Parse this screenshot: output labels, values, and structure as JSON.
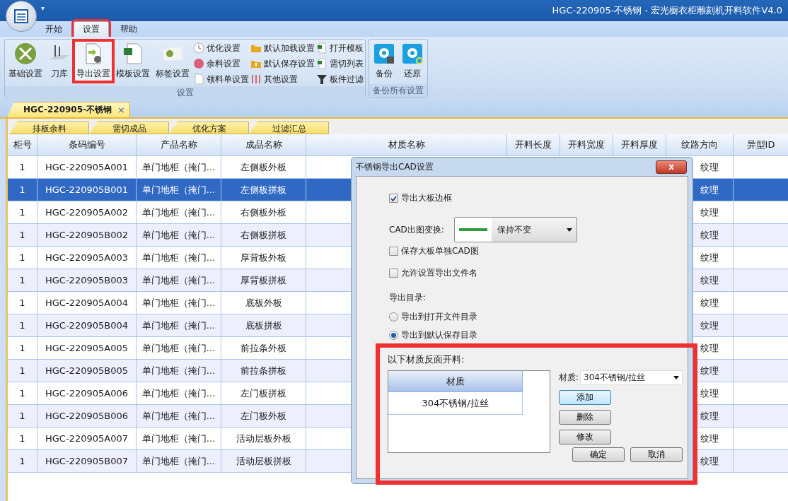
{
  "window": {
    "title": "HGC-220905-不锈钢 - 宏光橱衣柜雕刻机开料软件V4.0",
    "menu_caret": "▾"
  },
  "ribbon": {
    "tabs": [
      {
        "label": "开始",
        "selected": false,
        "highlighted": false
      },
      {
        "label": "设置",
        "selected": true,
        "highlighted": true
      },
      {
        "label": "帮助",
        "selected": false,
        "highlighted": false
      }
    ],
    "groups": [
      {
        "label": "设置",
        "large_buttons": [
          {
            "label": "基础设置",
            "highlighted": false
          },
          {
            "label": "刀库",
            "highlighted": false
          },
          {
            "label": "导出设置",
            "highlighted": true
          },
          {
            "label": "模板设置",
            "highlighted": false
          },
          {
            "label": "标签设置",
            "highlighted": false
          }
        ],
        "small_columns": [
          [
            "优化设置",
            "余料设置",
            "领料单设置"
          ],
          [
            "默认加载设置",
            "默认保存设置",
            "其他设置"
          ],
          [
            "打开模板",
            "需切列表",
            "板件过滤"
          ]
        ]
      },
      {
        "label": "备份所有设置",
        "large_buttons": [
          {
            "label": "备份",
            "highlighted": false
          },
          {
            "label": "还原",
            "highlighted": false
          }
        ]
      }
    ]
  },
  "document_tabs": [
    {
      "label": "HGC-220905-不锈钢",
      "close": "×",
      "selected": true
    }
  ],
  "sub_tabs": [
    "排板余料",
    "需切成品",
    "优化方案",
    "过滤汇总"
  ],
  "table": {
    "columns": [
      "柜号",
      "条码编号",
      "产品名称",
      "成品名称",
      "材质名称",
      "开料长度",
      "开料宽度",
      "开料厚度",
      "纹路方向",
      "异型ID"
    ],
    "rows": [
      {
        "cabinet": "1",
        "barcode": "HGC-220905A001",
        "product": "单门地柜（掩门...",
        "part": "左侧板外板",
        "grain": "纹理",
        "selected": false
      },
      {
        "cabinet": "1",
        "barcode": "HGC-220905B001",
        "product": "单门地柜（掩门...",
        "part": "左侧板拼板",
        "grain": "纹理",
        "selected": true
      },
      {
        "cabinet": "1",
        "barcode": "HGC-220905A002",
        "product": "单门地柜（掩门...",
        "part": "右侧板外板",
        "grain": "纹理",
        "selected": false
      },
      {
        "cabinet": "1",
        "barcode": "HGC-220905B002",
        "product": "单门地柜（掩门...",
        "part": "右侧板拼板",
        "grain": "纹理",
        "selected": false
      },
      {
        "cabinet": "1",
        "barcode": "HGC-220905A003",
        "product": "单门地柜（掩门...",
        "part": "厚背板外板",
        "grain": "纹理",
        "selected": false
      },
      {
        "cabinet": "1",
        "barcode": "HGC-220905B003",
        "product": "单门地柜（掩门...",
        "part": "厚背板拼板",
        "grain": "纹理",
        "selected": false
      },
      {
        "cabinet": "1",
        "barcode": "HGC-220905A004",
        "product": "单门地柜（掩门...",
        "part": "底板外板",
        "grain": "纹理",
        "selected": false
      },
      {
        "cabinet": "1",
        "barcode": "HGC-220905B004",
        "product": "单门地柜（掩门...",
        "part": "底板拼板",
        "grain": "纹理",
        "selected": false
      },
      {
        "cabinet": "1",
        "barcode": "HGC-220905A005",
        "product": "单门地柜（掩门...",
        "part": "前拉条外板",
        "grain": "纹理",
        "selected": false
      },
      {
        "cabinet": "1",
        "barcode": "HGC-220905B005",
        "product": "单门地柜（掩门...",
        "part": "前拉条拼板",
        "grain": "纹理",
        "selected": false
      },
      {
        "cabinet": "1",
        "barcode": "HGC-220905A006",
        "product": "单门地柜（掩门...",
        "part": "左门板拼板",
        "grain": "纹理",
        "selected": false
      },
      {
        "cabinet": "1",
        "barcode": "HGC-220905B006",
        "product": "单门地柜（掩门...",
        "part": "左门板外板",
        "grain": "纹理",
        "selected": false
      },
      {
        "cabinet": "1",
        "barcode": "HGC-220905A007",
        "product": "单门地柜（掩门...",
        "part": "活动层板外板",
        "grain": "纹理",
        "selected": false
      },
      {
        "cabinet": "1",
        "barcode": "HGC-220905B007",
        "product": "单门地柜（掩门...",
        "part": "活动层板拼板",
        "grain": "纹理",
        "selected": false
      }
    ]
  },
  "dialog": {
    "title": "不锈钢导出CAD设置",
    "close": "x",
    "options": [
      {
        "kind": "checkbox",
        "label": "导出大板边框",
        "checked": true
      },
      {
        "kind": "dropdown",
        "label": "CAD出图变换:",
        "value": "保持不变"
      },
      {
        "kind": "checkbox",
        "label": "保存大板单独CAD图",
        "checked": false
      },
      {
        "kind": "checkbox",
        "label": "允许设置导出文件名",
        "checked": false
      },
      {
        "kind": "heading",
        "label": "导出目录:"
      },
      {
        "kind": "radio",
        "label": "导出到打开文件目录",
        "selected": false
      },
      {
        "kind": "radio",
        "label": "导出到默认保存目录",
        "selected": true
      }
    ],
    "reverse_section": {
      "label": "以下材质反面开料:",
      "highlighted": true,
      "list_column": "材质",
      "list_rows": [
        "304不锈钢/拉丝"
      ],
      "material": {
        "label": "材质:",
        "value": "304不锈钢/拉丝"
      },
      "buttons": [
        {
          "label": "添加",
          "focused": true
        },
        {
          "label": "删除",
          "focused": false
        },
        {
          "label": "修改",
          "focused": false
        }
      ],
      "footer_buttons": [
        "确定",
        "取消"
      ]
    }
  }
}
